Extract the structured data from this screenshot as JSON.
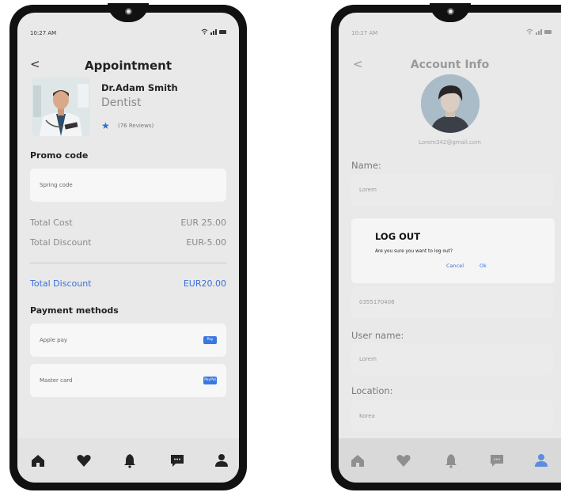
{
  "left": {
    "status_time": "10:27 AM",
    "title": "Appointment",
    "back": "<",
    "doctor": {
      "name": "Dr.Adam Smith",
      "specialty": "Dentist",
      "reviews": "(76 Reviews)"
    },
    "promo": {
      "heading": "Promo code",
      "value": "Spring code"
    },
    "summary": {
      "total_cost_label": "Total Cost",
      "total_cost_value": "EUR 25.00",
      "total_discount_label": "Total Discount",
      "total_discount_value": "EUR-5.00",
      "final_label": "Total Discount",
      "final_value": "EUR20.00"
    },
    "payment": {
      "heading": "Payment methods",
      "methods": [
        {
          "label": "Apple pay",
          "badge": "Pay"
        },
        {
          "label": "Master card",
          "badge": "PayPal"
        }
      ]
    },
    "tabs": [
      "home-icon",
      "heart-icon",
      "bell-icon",
      "chat-icon",
      "profile-icon"
    ]
  },
  "right": {
    "status_time": "10:27 AM",
    "title": "Account Info",
    "back": "<",
    "email": "Lorem342@gmail.com",
    "fields": {
      "name_label": "Name:",
      "name_value": "Lorem",
      "phone_value": "0355170406",
      "username_label": "User name:",
      "username_value": "Lorem",
      "location_label": "Location:",
      "location_value": "Korea"
    },
    "dialog": {
      "title": "LOG OUT",
      "message": "Are you sure you want to log out?",
      "cancel": "Cancel",
      "ok": "Ok"
    },
    "tabs": [
      "home-icon",
      "heart-icon",
      "bell-icon",
      "chat-icon",
      "profile-icon"
    ]
  },
  "colors": {
    "accent": "#3a6fd8",
    "frame": "#111111",
    "screen": "#e9e9e9"
  }
}
